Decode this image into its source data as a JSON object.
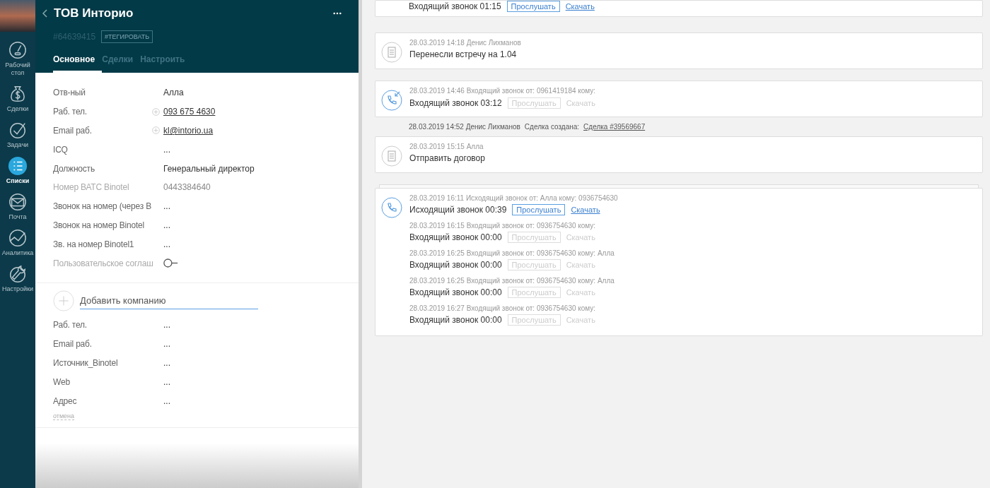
{
  "nav": {
    "items": [
      {
        "label": "Рабочий стол",
        "selected": false
      },
      {
        "label": "Сделки",
        "selected": false
      },
      {
        "label": "Задачи",
        "selected": false
      },
      {
        "label": "Списки",
        "selected": true
      },
      {
        "label": "Почта",
        "selected": false
      },
      {
        "label": "Аналитика",
        "selected": false
      },
      {
        "label": "Настройки",
        "selected": false
      }
    ]
  },
  "contact": {
    "title": "ТОВ Инторио",
    "id": "#64639415",
    "tag_button": "#ТЕГИРОВАТЬ",
    "tabs": [
      {
        "label": "Основное",
        "selected": true
      },
      {
        "label": "Сделки",
        "selected": false
      },
      {
        "label": "Настроить",
        "selected": false
      }
    ],
    "fields": [
      {
        "label": "Отв-ный",
        "kind": "text",
        "value": "Алла",
        "disabled": false
      },
      {
        "label": "Раб. тел.",
        "kind": "link",
        "value": "093 675 4630",
        "disabled": false
      },
      {
        "label": "Email раб.",
        "kind": "link",
        "value": "kl@intorio.ua",
        "disabled": false
      },
      {
        "label": "ICQ",
        "kind": "text",
        "value": "...",
        "disabled": false
      },
      {
        "label": "Должность",
        "kind": "text",
        "value": "Генеральный директор",
        "disabled": false
      },
      {
        "label": "Номер ВАТС Binotel",
        "kind": "text",
        "value": "0443384640",
        "disabled": true
      },
      {
        "label": "Звонок на номер (через В",
        "kind": "text",
        "value": "...",
        "disabled": false
      },
      {
        "label": "Звонок на номер Binotel",
        "kind": "text",
        "value": "...",
        "disabled": false
      },
      {
        "label": "Зв. на номер Binotel1",
        "kind": "text",
        "value": "...",
        "disabled": false
      },
      {
        "label": "Пользовательское соглаш",
        "kind": "toggle",
        "checked": false,
        "disabled": true
      }
    ]
  },
  "company": {
    "placeholder": "Добавить компанию",
    "fields": [
      {
        "label": "Раб. тел.",
        "value": "..."
      },
      {
        "label": "Email раб.",
        "value": "..."
      },
      {
        "label": "Источник_Binotel",
        "value": "..."
      },
      {
        "label": "Web",
        "value": "..."
      },
      {
        "label": "Адрес",
        "value": "..."
      }
    ],
    "cancel": "отмена"
  },
  "feed": [
    {
      "kind": "call_cut",
      "title": "Входящий звонок 01:15",
      "listen": "Прослушать",
      "download": "Скачать",
      "disabled": false
    },
    {
      "kind": "note",
      "meta": "28.03.2019 14:18 Денис Лихманов",
      "text": "Перенесли встречу на 1.04"
    },
    {
      "kind": "incoming_call",
      "meta": "28.03.2019 14:46 Входящий звонок от: 0961419184 кому:",
      "title": "Входящий звонок 03:12",
      "listen": "Прослушать",
      "download": "Скачать",
      "disabled": true
    },
    {
      "kind": "event",
      "meta": "28.03.2019 14:52 Денис Лихманов",
      "action": "Сделка создана:",
      "link": "Сделка #39569667"
    },
    {
      "kind": "note",
      "meta": "28.03.2019 15:15 Алла",
      "text": "Отправить договор"
    },
    {
      "kind": "call_group",
      "calls": [
        {
          "meta": "28.03.2019 16:11 Исходящий звонок от: Алла кому: 0936754630",
          "title": "Исходящий звонок 00:39",
          "listen": "Прослушать",
          "download": "Скачать",
          "disabled": false
        },
        {
          "meta": "28.03.2019 16:15 Входящий звонок от: 0936754630 кому:",
          "title": "Входящий звонок 00:00",
          "listen": "Прослушать",
          "download": "Скачать",
          "disabled": true
        },
        {
          "meta": "28.03.2019 16:25 Входящий звонок от: 0936754630 кому: Алла",
          "title": "Входящий звонок 00:00",
          "listen": "Прослушать",
          "download": "Скачать",
          "disabled": true
        },
        {
          "meta": "28.03.2019 16:25 Входящий звонок от: 0936754630 кому: Алла",
          "title": "Входящий звонок 00:00",
          "listen": "Прослушать",
          "download": "Скачать",
          "disabled": true
        },
        {
          "meta": "28.03.2019 16:27 Входящий звонок от: 0936754630 кому:",
          "title": "Входящий звонок 00:00",
          "listen": "Прослушать",
          "download": "Скачать",
          "disabled": true
        }
      ]
    }
  ]
}
